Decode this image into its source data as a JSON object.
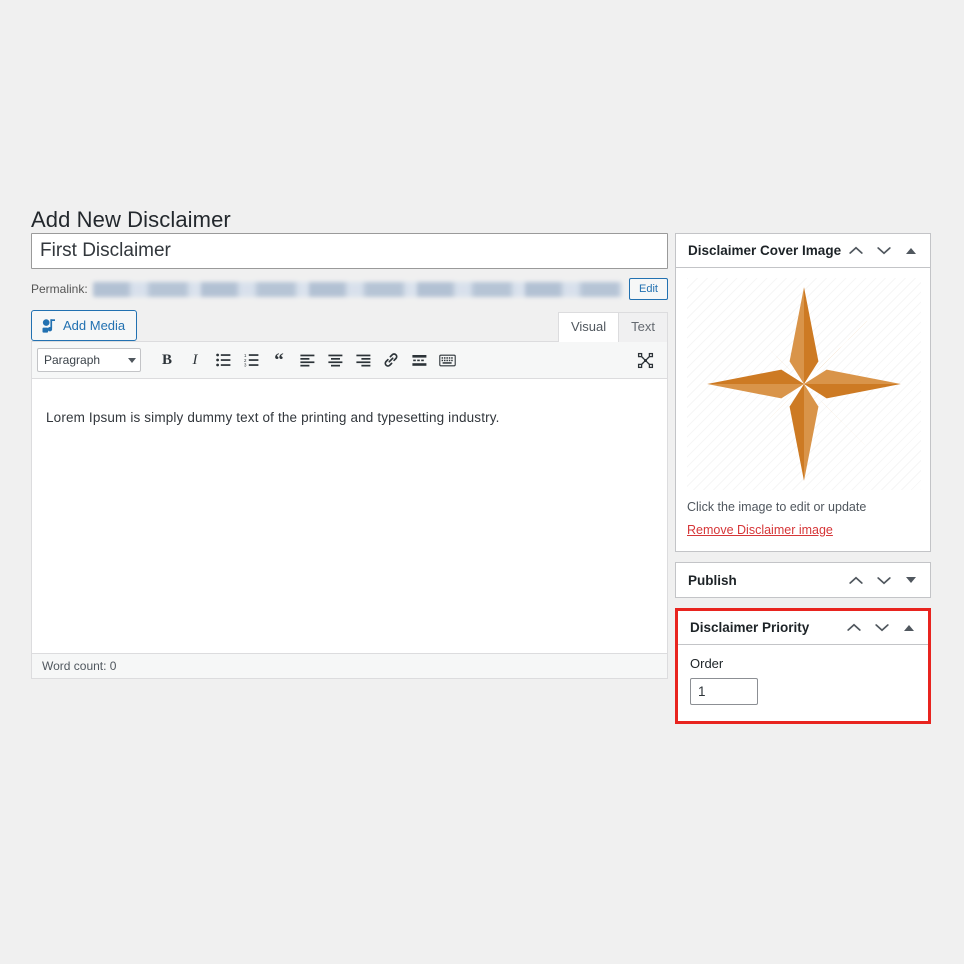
{
  "page": {
    "title": "Add New Disclaimer",
    "background_color": "#f0f0f0"
  },
  "post": {
    "title_value": "First Disclaimer",
    "title_placeholder": "Enter title here",
    "permalink_label": "Permalink:",
    "permalink_value": "",
    "permalink_edit_label": "Edit"
  },
  "editor": {
    "add_media_label": "Add Media",
    "add_media_icon": "media-icon",
    "tabs": [
      {
        "label": "Visual",
        "active": true
      },
      {
        "label": "Text",
        "active": false
      }
    ],
    "format_select_value": "Paragraph",
    "toolbar_buttons": [
      {
        "name": "bold-icon",
        "label": "B"
      },
      {
        "name": "italic-icon",
        "label": "I"
      },
      {
        "name": "bulleted-list-icon",
        "label": ""
      },
      {
        "name": "numbered-list-icon",
        "label": ""
      },
      {
        "name": "blockquote-icon",
        "label": "“"
      },
      {
        "name": "align-left-icon",
        "label": ""
      },
      {
        "name": "align-center-icon",
        "label": ""
      },
      {
        "name": "align-right-icon",
        "label": ""
      },
      {
        "name": "link-icon",
        "label": ""
      },
      {
        "name": "read-more-icon",
        "label": ""
      },
      {
        "name": "keyboard-shortcuts-icon",
        "label": ""
      }
    ],
    "fullscreen_icon": "distraction-free-icon",
    "content": "Lorem Ipsum is simply dummy text of the printing and typesetting industry.",
    "word_count": "Word count: 0"
  },
  "sidebar": {
    "cover_image_panel": {
      "title": "Disclaimer Cover Image",
      "collapse_up_icon": "chevron-up-icon",
      "collapse_down_icon": "chevron-down-icon",
      "toggle_icon": "triangle-up-icon",
      "image_alt": "eight-pointed-star-image",
      "image_colors": {
        "light": "#d99449",
        "dark": "#cd7a23"
      },
      "caption": "Click the image to edit or update",
      "remove_link": "Remove Disclaimer image",
      "remove_link_color": "#d63638"
    },
    "publish_panel": {
      "title": "Publish",
      "collapse_up_icon": "chevron-up-icon",
      "collapse_down_icon": "chevron-down-icon",
      "toggle_icon": "triangle-down-icon"
    },
    "priority_panel": {
      "title": "Disclaimer Priority",
      "collapse_up_icon": "chevron-up-icon",
      "collapse_down_icon": "chevron-down-icon",
      "toggle_icon": "triangle-up-icon",
      "order_label": "Order",
      "order_value": "1",
      "highlight_color": "#e8241f"
    }
  }
}
